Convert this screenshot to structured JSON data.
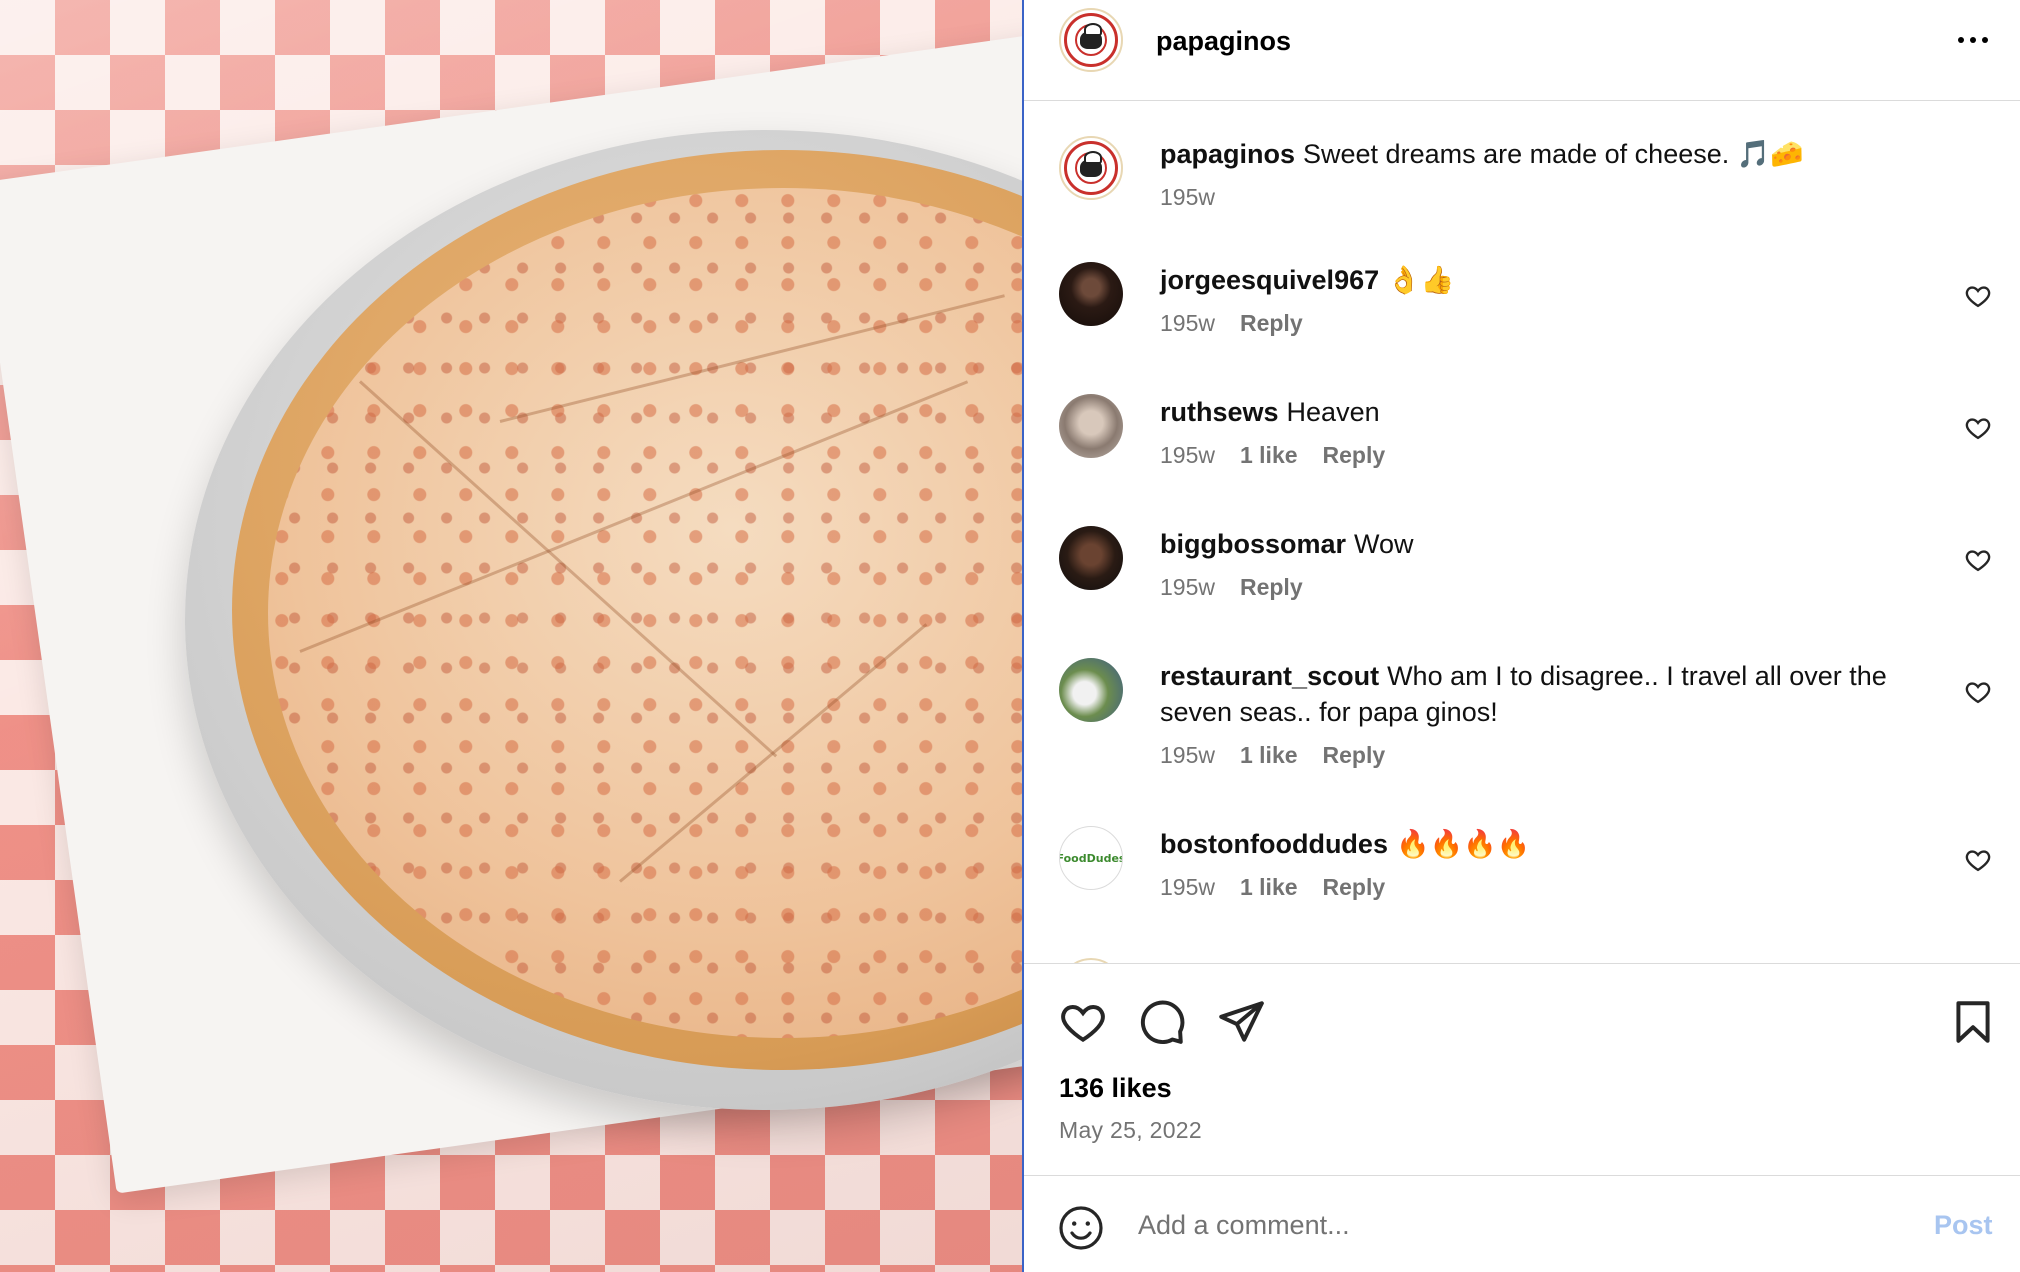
{
  "post": {
    "username": "papaginos",
    "caption_user": "papaginos",
    "caption_text": "Sweet dreams are made of cheese. 🎵🧀",
    "caption_time": "195w"
  },
  "comments": [
    {
      "username": "jorgeesquivel967",
      "text": "👌👍",
      "time": "195w",
      "likes": "",
      "reply": "Reply"
    },
    {
      "username": "ruthsews",
      "text": "Heaven",
      "time": "195w",
      "likes": "1 like",
      "reply": "Reply"
    },
    {
      "username": "biggbossomar",
      "text": "Wow",
      "time": "195w",
      "likes": "",
      "reply": "Reply"
    },
    {
      "username": "restaurant_scout",
      "text": "Who am I to disagree.. I travel all over the seven seas.. for papa ginos!",
      "time": "195w",
      "likes": "1 like",
      "reply": "Reply"
    },
    {
      "username": "bostonfooddudes",
      "text": "🔥🔥🔥🔥",
      "time": "195w",
      "likes": "1 like",
      "reply": "Reply"
    }
  ],
  "avatar_text": {
    "bostonfooddudes": "FoodDudes"
  },
  "engagement": {
    "likes": "136 likes",
    "date": "May 25, 2022"
  },
  "comment_box": {
    "placeholder": "Add a comment...",
    "post_label": "Post"
  },
  "icons": [
    "more-icon",
    "heart-icon",
    "comment-icon",
    "share-icon",
    "bookmark-icon",
    "emoji-icon"
  ],
  "colors": {
    "link_blue_disabled": "#a8c5f0",
    "meta_gray": "#737373",
    "divider": "#dbdbdb"
  }
}
